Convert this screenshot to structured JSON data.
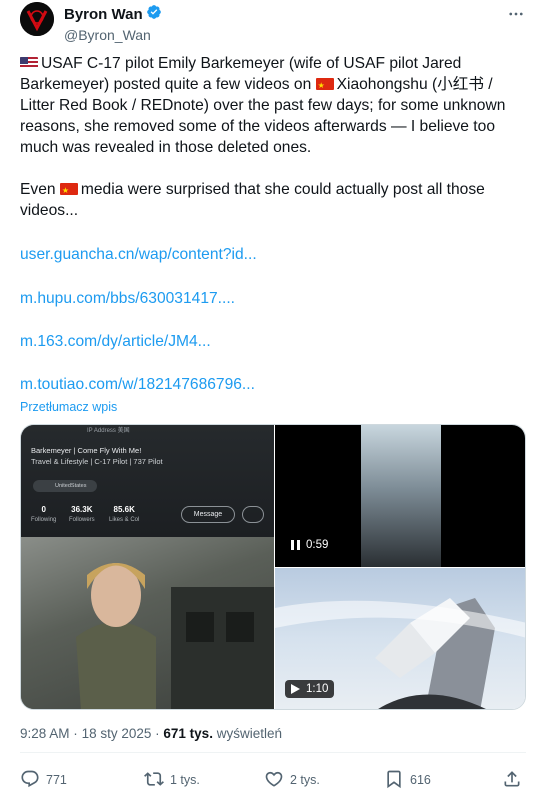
{
  "author": {
    "display_name": "Byron Wan",
    "handle": "@Byron_Wan",
    "verified": true
  },
  "menu_icon": "more-horizontal-icon",
  "post": {
    "paragraph1_after_us_flag": "USAF C-17 pilot Emily Barkemeyer (wife of USAF pilot Jared Barkemeyer) posted quite a few videos on ",
    "paragraph1_after_cn_flag": "Xiaohongshu (小红书 / Litter Red Book / REDnote) over the past few days; for some unknown reasons, she removed some of the videos afterwards — I believe too much was revealed in those deleted ones.",
    "paragraph2_before_flag": "Even ",
    "paragraph2_after_flag": "media were surprised that she could actually post all those videos...",
    "links": [
      "user.guancha.cn/wap/content?id...",
      "m.hupu.com/bbs/630031417....",
      "m.163.com/dy/article/JM4...",
      "m.toutiao.com/w/182147686796..."
    ],
    "translate_label": "Przetłumacz wpis"
  },
  "media": {
    "profile_card": {
      "address_label": "IP Address 美国",
      "name_line": "Barkemeyer | Come Fly With Me!",
      "bio_line": "Travel & Lifestyle | C-17 Pilot | 737 Pilot",
      "location_chip": "UnitedStates",
      "stats": [
        {
          "value": "0",
          "label": "Following"
        },
        {
          "value": "36.3K",
          "label": "Followers"
        },
        {
          "value": "85.6K",
          "label": "Likes & Col"
        }
      ],
      "message_button": "Message"
    },
    "video1_duration": "0:59",
    "video2_duration": "1:10"
  },
  "meta": {
    "time": "9:28 AM",
    "separator": "·",
    "date": "18 sty 2025",
    "views_count": "671 tys.",
    "views_label": "wyświetleń"
  },
  "actions": {
    "replies": "771",
    "reposts": "1 tys.",
    "likes": "2 tys.",
    "bookmarks": "616"
  },
  "colors": {
    "link": "#1d9bf0",
    "verified": "#1d9bf0",
    "secondary_text": "#536471"
  }
}
